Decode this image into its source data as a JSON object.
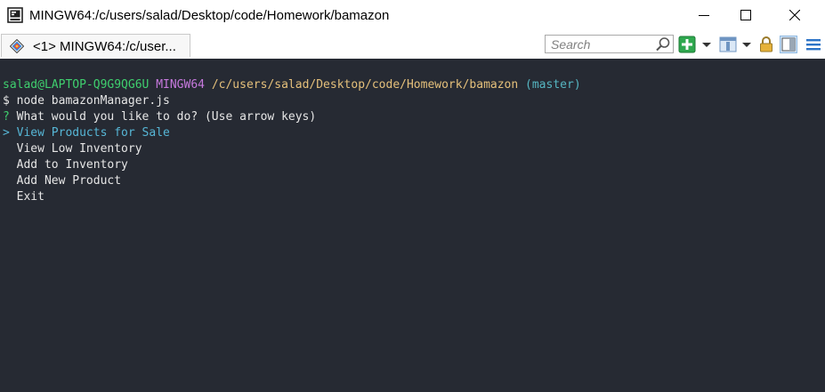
{
  "window": {
    "title": "MINGW64:/c/users/salad/Desktop/code/Homework/bamazon"
  },
  "tabbar": {
    "tab_label": "<1> MINGW64:/c/user...",
    "search_placeholder": "Search"
  },
  "icons": {
    "app": "terminal-app-icon",
    "tab": "mintty-tab-icon",
    "search": "search-icon",
    "new_tab": "plus-icon",
    "view": "view-icon",
    "lock": "lock-icon",
    "panel": "panel-icon",
    "menu": "hamburger-menu-icon"
  },
  "terminal": {
    "prompt_user": "salad@LAPTOP-Q9G9QG6U",
    "prompt_shell": "MINGW64",
    "prompt_path": "/c/users/salad/Desktop/code/Homework/bamazon",
    "prompt_branch": "(master)",
    "command_prefix": "$",
    "command": "node bamazonManager.js",
    "question_mark": "?",
    "question": "What would you like to do? (Use arrow keys)",
    "selector": ">",
    "options": [
      "View Products for Sale",
      "View Low Inventory",
      "Add to Inventory",
      "Add New Product",
      "Exit"
    ],
    "selected_index": 0
  },
  "colors": {
    "background": "#262a33",
    "user": "#3fcf6e",
    "shell": "#c679dd",
    "path": "#e5c07b",
    "branch": "#56b6c2",
    "selected": "#56b6d6",
    "text": "#e6e6e6"
  }
}
